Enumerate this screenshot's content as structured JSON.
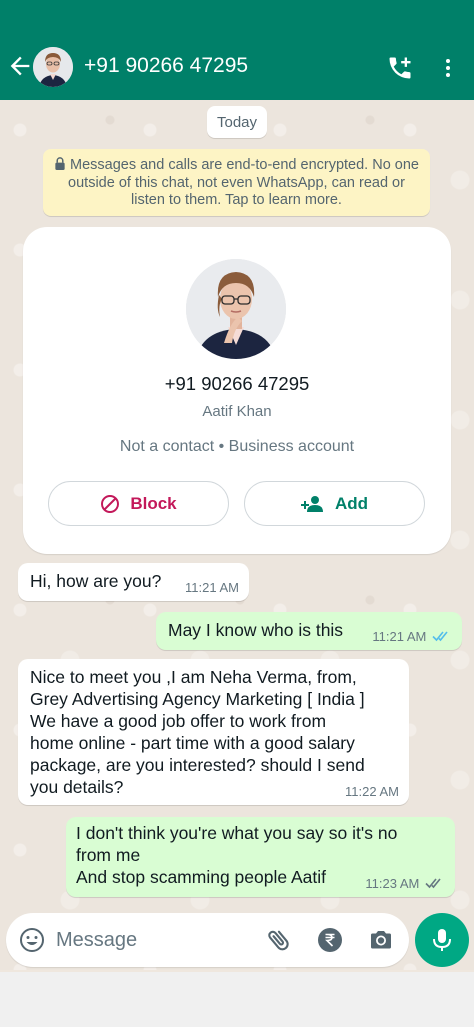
{
  "header": {
    "title": "+91 90266 47295",
    "icons": [
      "back-arrow-icon",
      "avatar",
      "add-call-icon",
      "more-vert-icon"
    ]
  },
  "chat": {
    "date_chip": "Today",
    "encryption_notice": "Messages and calls are end-to-end encrypted. No one outside of this chat, not even WhatsApp, can read or listen to them. Tap to learn more."
  },
  "contact_card": {
    "number": "+91 90266 47295",
    "name": "Aatif Khan",
    "subtitle": "Not a contact • Business account",
    "block_label": "Block",
    "add_label": "Add"
  },
  "messages": [
    {
      "direction": "incoming",
      "text": "Hi, how are you?",
      "time": "11:21 AM"
    },
    {
      "direction": "outgoing",
      "text": "May I know who is this",
      "time": "11:21 AM",
      "status": "read"
    },
    {
      "direction": "incoming",
      "text": "Nice to meet you ,I am Neha Verma, from,\nGrey Advertising Agency Marketing [ India ]\nWe have a good job offer to work from\nhome online - part time with a good salary\npackage, are you interested? should I send\nyou details?",
      "time": "11:22 AM"
    },
    {
      "direction": "outgoing",
      "text": "I don't think you're what you say so it's no\nfrom me\nAnd stop scamming people Aatif",
      "time": "11:23 AM",
      "status": "delivered"
    }
  ],
  "composer": {
    "placeholder": "Message"
  },
  "colors": {
    "header": "#008069",
    "accent": "#00a884",
    "outgoing_bubble": "#d9fdd3",
    "incoming_bubble": "#ffffff",
    "block": "#c3185a",
    "read_ticks": "#53bdeb"
  }
}
